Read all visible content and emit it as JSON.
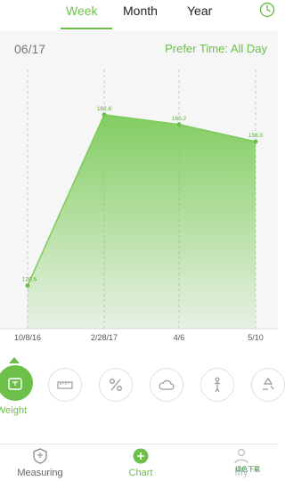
{
  "tabs": [
    {
      "label": "Week",
      "active": true
    },
    {
      "label": "Month",
      "active": false
    },
    {
      "label": "Year",
      "active": false
    }
  ],
  "header": {
    "date": "06/17",
    "prefer_time": "Prefer Time: All Day"
  },
  "chart_data": {
    "type": "area",
    "x": [
      "10/8/16",
      "2/28/17",
      "4/6",
      "5/10"
    ],
    "series": [
      {
        "values": [
          120.6,
          162.6,
          160.2,
          156.0
        ]
      }
    ],
    "ylim": [
      110,
      170
    ],
    "grid": "vertical-dashed",
    "color": "#7dcb5a"
  },
  "categories": [
    {
      "icon": "scale-icon",
      "label": "Weight",
      "active": true
    },
    {
      "icon": "ruler-icon",
      "label": "",
      "active": false
    },
    {
      "icon": "percent-icon",
      "label": "",
      "active": false
    },
    {
      "icon": "cloud-icon",
      "label": "",
      "active": false
    },
    {
      "icon": "body-icon",
      "label": "",
      "active": false
    },
    {
      "icon": "recycle-icon",
      "label": "",
      "active": false
    }
  ],
  "bottom_nav": [
    {
      "label": "Measuring",
      "icon": "shield-icon",
      "active": false
    },
    {
      "label": "Chart",
      "icon": "plus-icon",
      "active": true
    },
    {
      "label": "My",
      "icon": "person-icon",
      "active": false
    }
  ],
  "watermark": "绿色下载",
  "colors": {
    "accent": "#6cc04a",
    "area": "#7dcb5a"
  }
}
